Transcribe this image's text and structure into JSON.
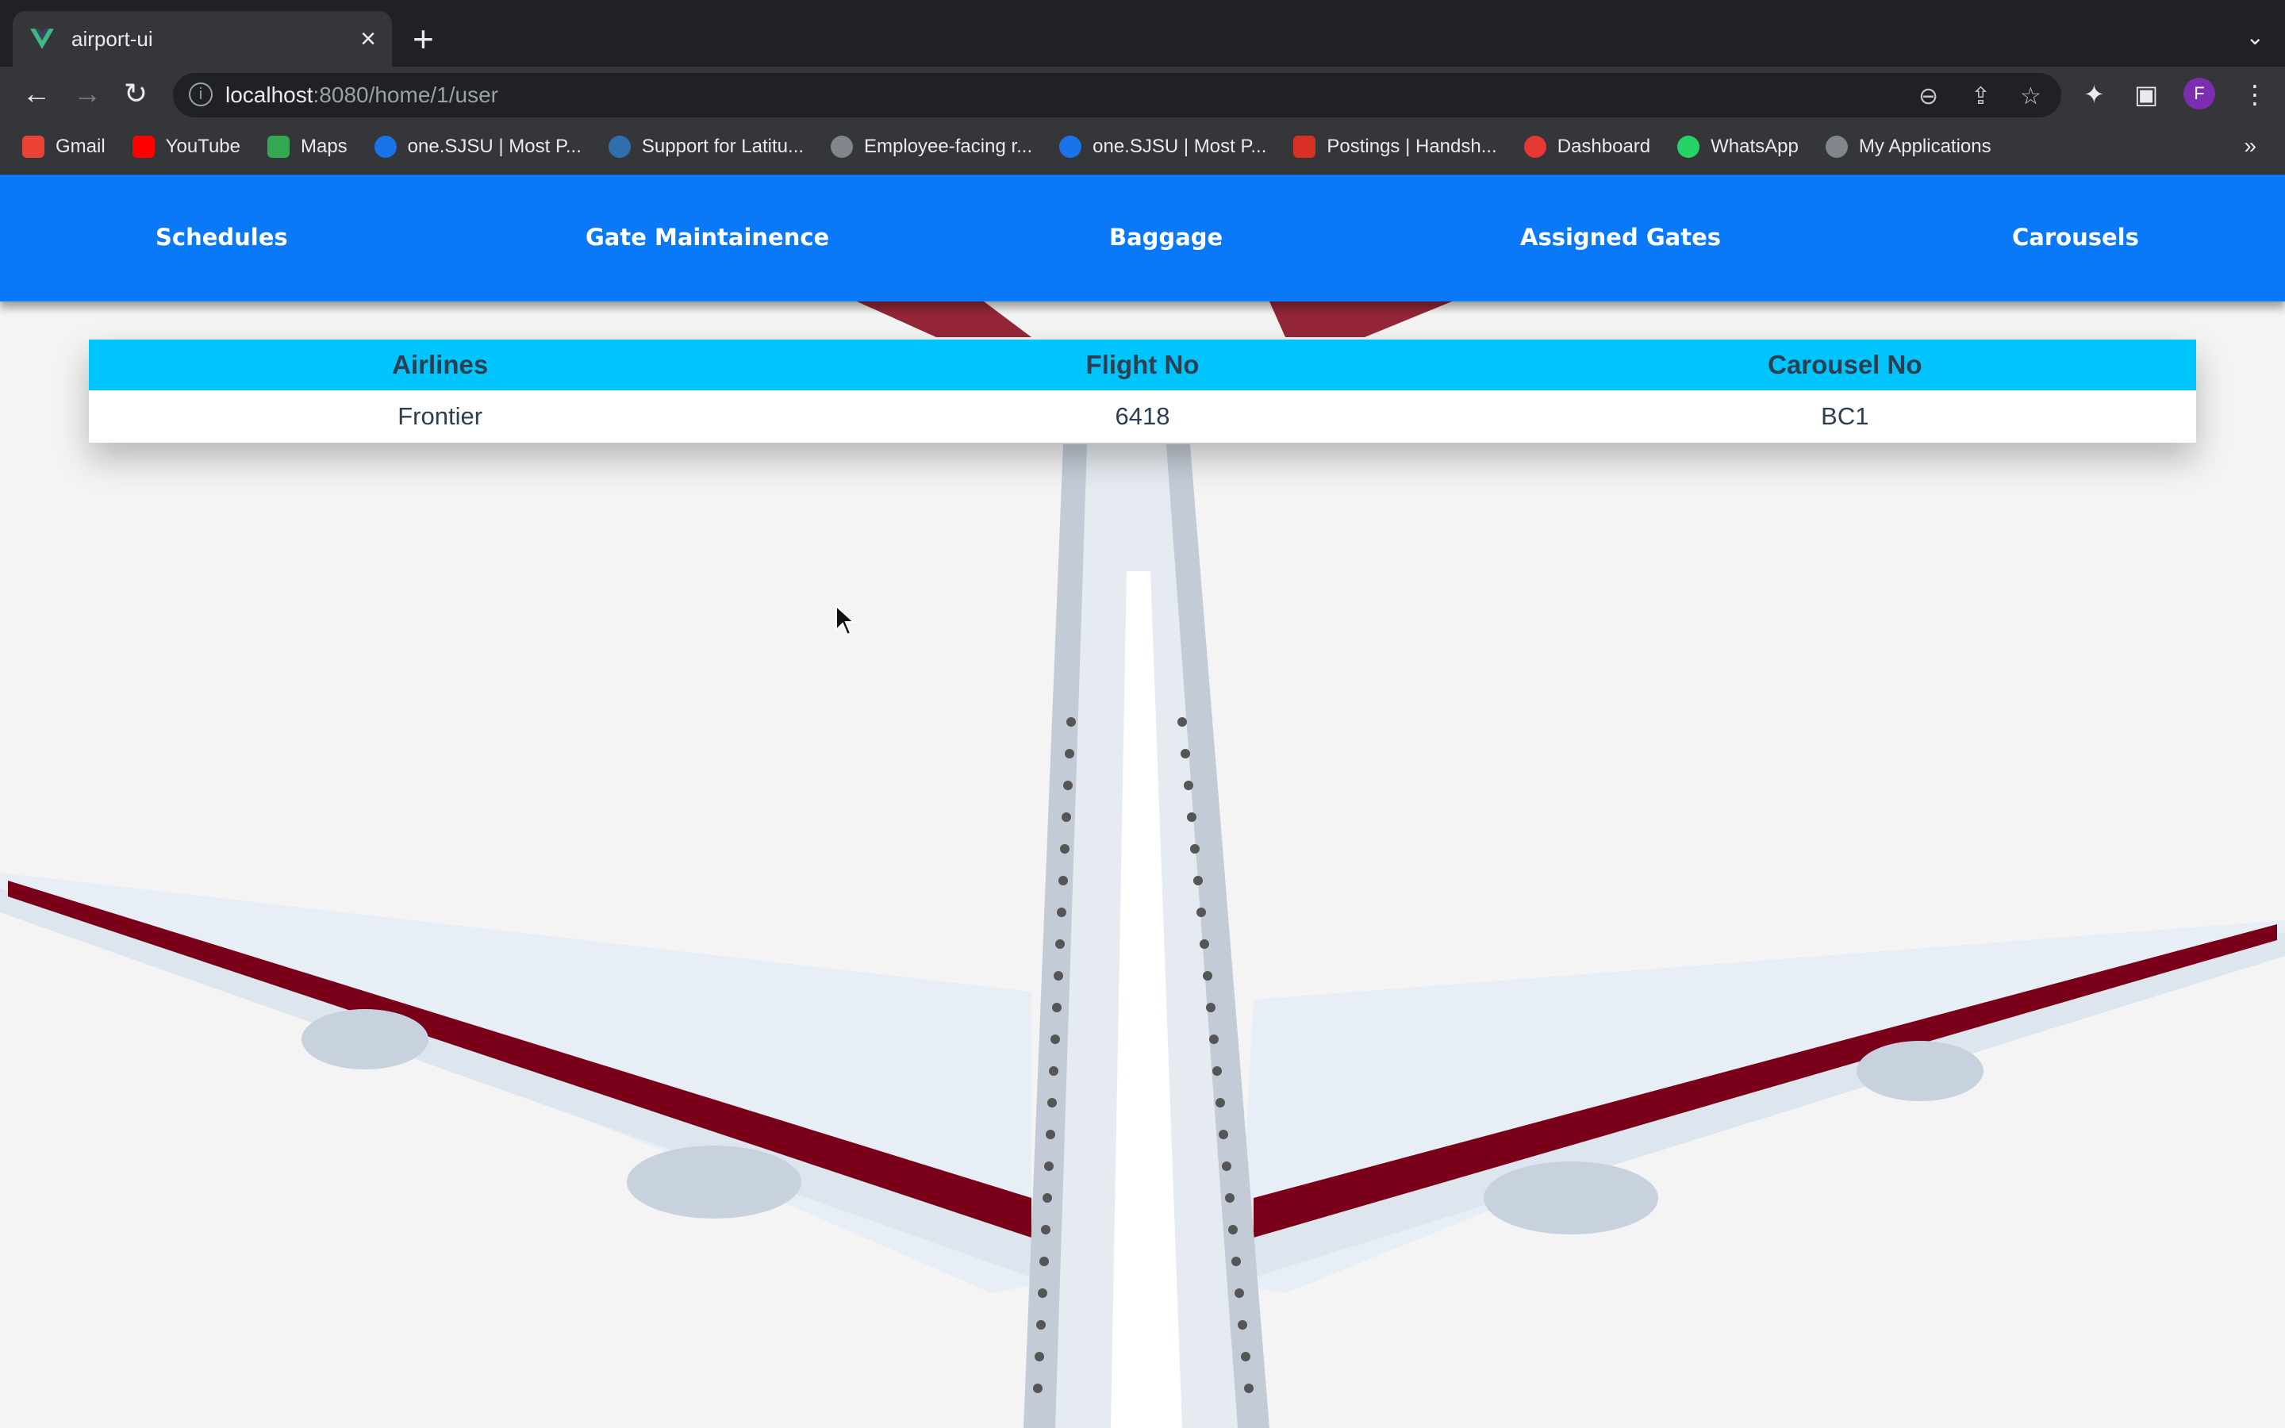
{
  "browser": {
    "tab_title": "airport-ui",
    "url_host": "localhost",
    "url_rest": ":8080/home/1/user",
    "profile_initial": "F",
    "bookmarks": [
      {
        "label": "Gmail",
        "color": "#ea4335"
      },
      {
        "label": "YouTube",
        "color": "#ff0000"
      },
      {
        "label": "Maps",
        "color": "#34a853"
      },
      {
        "label": "one.SJSU | Most P...",
        "color": "#1a73e8"
      },
      {
        "label": "Support for Latitu...",
        "color": "#2f6fb0"
      },
      {
        "label": "Employee-facing r...",
        "color": "#80868b"
      },
      {
        "label": "one.SJSU | Most P...",
        "color": "#1a73e8"
      },
      {
        "label": "Postings | Handsh...",
        "color": "#d93025"
      },
      {
        "label": "Dashboard",
        "color": "#e53935"
      },
      {
        "label": "WhatsApp",
        "color": "#25d366"
      },
      {
        "label": "My Applications",
        "color": "#80868b"
      }
    ]
  },
  "nav": {
    "items": [
      {
        "label": "Schedules"
      },
      {
        "label": "Gate Maintainence"
      },
      {
        "label": "Baggage"
      },
      {
        "label": "Assigned Gates"
      },
      {
        "label": "Carousels"
      }
    ]
  },
  "table": {
    "headers": [
      "Airlines",
      "Flight No",
      "Carousel No"
    ],
    "rows": [
      [
        "Frontier",
        "6418",
        "BC1"
      ]
    ]
  },
  "colors": {
    "nav_bg": "#0a79f7",
    "table_header_bg": "#00c4fc",
    "page_bg": "#f4f4f4",
    "plane_stripe": "#7a0019"
  }
}
